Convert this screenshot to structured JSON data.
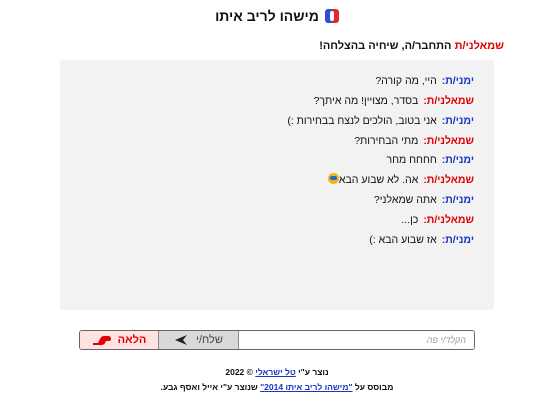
{
  "header": {
    "title": "מישהו לריב איתו"
  },
  "status": {
    "who": "שמאלני/ת",
    "text": "התחבר/ה, שיחיה בהצלחה!"
  },
  "messages": [
    {
      "who": "ימני/ת:",
      "side": "blue",
      "text": "היי, מה קורה?"
    },
    {
      "who": "שמאלני/ת:",
      "side": "red",
      "text": "בסדר, מצויין! מה איתך?"
    },
    {
      "who": "ימני/ת:",
      "side": "blue",
      "text": "אני בטוב, הולכים לנצח בבחירות :)"
    },
    {
      "who": "שמאלני/ת:",
      "side": "red",
      "text": "מתי הבחירות?"
    },
    {
      "who": "ימני/ת:",
      "side": "blue",
      "text": "חחחח מחר"
    },
    {
      "who": "שמאלני/ת:",
      "side": "red",
      "text": "אה. לא שבוע הבא"
    },
    {
      "who": "ימני/ת:",
      "side": "blue",
      "text": "אתה שמאלני?"
    },
    {
      "who": "שמאלני/ת:",
      "side": "red",
      "text": "כן..."
    },
    {
      "who": "ימני/ת:",
      "side": "blue",
      "text": "אז שבוע הבא :)"
    }
  ],
  "input": {
    "placeholder": "הקלד/י פה",
    "value": ""
  },
  "buttons": {
    "send": "שלח/י",
    "next": "הלאה"
  },
  "footer": {
    "line1_prefix": "נוצר ע\"י",
    "line1_link": "טל ישראלי",
    "line1_suffix": "© 2022",
    "line2_prefix": "מבוסס על",
    "line2_link": "\"מישהו לריב איתו 2014\"",
    "line2_suffix": "שנוצר ע\"י אייל ואסף גבע."
  }
}
